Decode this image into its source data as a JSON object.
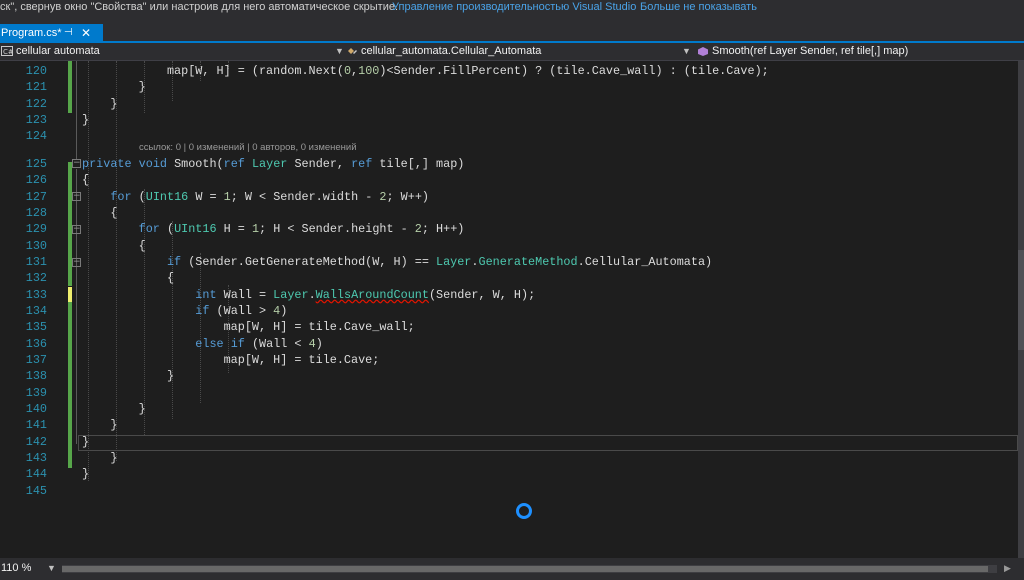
{
  "infobar": {
    "text": "ск\", свернув окно \"Свойства\" или настроив для него автоматическое скрытие.",
    "link_manage": "Управление производительностью Visual Studio",
    "link_dismiss": "Больше не показывать"
  },
  "tab": {
    "title": "Program.cs*",
    "pin_glyph": "⊣",
    "close_glyph": "✕"
  },
  "navbar": {
    "project": "cellular automata",
    "class": "cellular_automata.Cellular_Automata",
    "member": "Smooth(ref Layer Sender, ref tile[,] map)"
  },
  "codelens": "ссылок: 0 | 0 изменений | 0 авторов, 0 изменений",
  "code": {
    "lines": [
      {
        "n": "120",
        "tokens": [
          {
            "t": "            map[W, H] = (random.Next(",
            "c": "p"
          },
          {
            "t": "0",
            "c": "num"
          },
          {
            "t": ",",
            "c": "p"
          },
          {
            "t": "100",
            "c": "num"
          },
          {
            "t": ")<Sender.FillPercent) ? (tile.Cave_wall) : (tile.Cave);",
            "c": "p"
          }
        ]
      },
      {
        "n": "121",
        "tokens": [
          {
            "t": "        }",
            "c": "p"
          }
        ]
      },
      {
        "n": "122",
        "tokens": [
          {
            "t": "    }",
            "c": "p"
          }
        ]
      },
      {
        "n": "123",
        "tokens": [
          {
            "t": "}",
            "c": "p"
          }
        ]
      },
      {
        "n": "124",
        "tokens": []
      },
      {
        "n": "125",
        "tokens": [
          {
            "t": "private",
            "c": "kw"
          },
          {
            "t": " ",
            "c": "p"
          },
          {
            "t": "void",
            "c": "kw"
          },
          {
            "t": " Smooth(",
            "c": "p"
          },
          {
            "t": "ref",
            "c": "kw"
          },
          {
            "t": " ",
            "c": "p"
          },
          {
            "t": "Layer",
            "c": "ty"
          },
          {
            "t": " Sender, ",
            "c": "p"
          },
          {
            "t": "ref",
            "c": "kw"
          },
          {
            "t": " tile[,] map)",
            "c": "p"
          }
        ]
      },
      {
        "n": "126",
        "tokens": [
          {
            "t": "{",
            "c": "p"
          }
        ]
      },
      {
        "n": "127",
        "tokens": [
          {
            "t": "    ",
            "c": "p"
          },
          {
            "t": "for",
            "c": "kw"
          },
          {
            "t": " (",
            "c": "p"
          },
          {
            "t": "UInt16",
            "c": "ty"
          },
          {
            "t": " W = ",
            "c": "p"
          },
          {
            "t": "1",
            "c": "num"
          },
          {
            "t": "; W < Sender.width - ",
            "c": "p"
          },
          {
            "t": "2",
            "c": "num"
          },
          {
            "t": "; W++)",
            "c": "p"
          }
        ]
      },
      {
        "n": "128",
        "tokens": [
          {
            "t": "    {",
            "c": "p"
          }
        ]
      },
      {
        "n": "129",
        "tokens": [
          {
            "t": "        ",
            "c": "p"
          },
          {
            "t": "for",
            "c": "kw"
          },
          {
            "t": " (",
            "c": "p"
          },
          {
            "t": "UInt16",
            "c": "ty"
          },
          {
            "t": " H = ",
            "c": "p"
          },
          {
            "t": "1",
            "c": "num"
          },
          {
            "t": "; H < Sender.height - ",
            "c": "p"
          },
          {
            "t": "2",
            "c": "num"
          },
          {
            "t": "; H++)",
            "c": "p"
          }
        ]
      },
      {
        "n": "130",
        "tokens": [
          {
            "t": "        {",
            "c": "p"
          }
        ]
      },
      {
        "n": "131",
        "tokens": [
          {
            "t": "            ",
            "c": "p"
          },
          {
            "t": "if",
            "c": "kw"
          },
          {
            "t": " (Sender.GetGenerateMethod(W, H) == ",
            "c": "p"
          },
          {
            "t": "Layer",
            "c": "ty"
          },
          {
            "t": ".",
            "c": "p"
          },
          {
            "t": "GenerateMethod",
            "c": "ty"
          },
          {
            "t": ".Cellular_Automata)",
            "c": "p"
          }
        ]
      },
      {
        "n": "132",
        "tokens": [
          {
            "t": "            {",
            "c": "p"
          }
        ]
      },
      {
        "n": "133",
        "tokens": [
          {
            "t": "                ",
            "c": "p"
          },
          {
            "t": "int",
            "c": "kw"
          },
          {
            "t": " Wall = ",
            "c": "p"
          },
          {
            "t": "Layer",
            "c": "ty"
          },
          {
            "t": ".",
            "c": "p"
          },
          {
            "t": "WallsAroundCount",
            "c": "sq"
          },
          {
            "t": "(Sender, W, H);",
            "c": "p"
          }
        ]
      },
      {
        "n": "134",
        "tokens": [
          {
            "t": "                ",
            "c": "p"
          },
          {
            "t": "if",
            "c": "kw"
          },
          {
            "t": " (Wall > ",
            "c": "p"
          },
          {
            "t": "4",
            "c": "num"
          },
          {
            "t": ")",
            "c": "p"
          }
        ]
      },
      {
        "n": "135",
        "tokens": [
          {
            "t": "                    map[W, H] = tile.Cave_wall;",
            "c": "p"
          }
        ]
      },
      {
        "n": "136",
        "tokens": [
          {
            "t": "                ",
            "c": "p"
          },
          {
            "t": "else",
            "c": "kw"
          },
          {
            "t": " ",
            "c": "p"
          },
          {
            "t": "if",
            "c": "kw"
          },
          {
            "t": " (Wall < ",
            "c": "p"
          },
          {
            "t": "4",
            "c": "num"
          },
          {
            "t": ")",
            "c": "p"
          }
        ]
      },
      {
        "n": "137",
        "tokens": [
          {
            "t": "                    map[W, H] = tile.Cave;",
            "c": "p"
          }
        ]
      },
      {
        "n": "138",
        "tokens": [
          {
            "t": "            }",
            "c": "p"
          }
        ]
      },
      {
        "n": "139",
        "tokens": []
      },
      {
        "n": "140",
        "tokens": [
          {
            "t": "        }",
            "c": "p"
          }
        ]
      },
      {
        "n": "141",
        "tokens": [
          {
            "t": "    }",
            "c": "p"
          }
        ]
      },
      {
        "n": "142",
        "tokens": [
          {
            "t": "}",
            "c": "p"
          }
        ]
      },
      {
        "n": "143",
        "tokens": [
          {
            "t": "    }",
            "c": "p"
          }
        ]
      },
      {
        "n": "144",
        "tokens": [
          {
            "t": "}",
            "c": "p"
          }
        ]
      },
      {
        "n": "145",
        "tokens": []
      }
    ]
  },
  "status": {
    "zoom": "110 %"
  },
  "colors": {
    "accent": "#007acc",
    "keyword": "#569cd6",
    "type": "#4ec9b0",
    "number": "#b5cea8",
    "text": "#dcdcdc",
    "line_number": "#2b91af",
    "saved_change": "#57a64a",
    "unsaved_change": "#efef6e",
    "busy_indicator": "#1e90ff"
  }
}
